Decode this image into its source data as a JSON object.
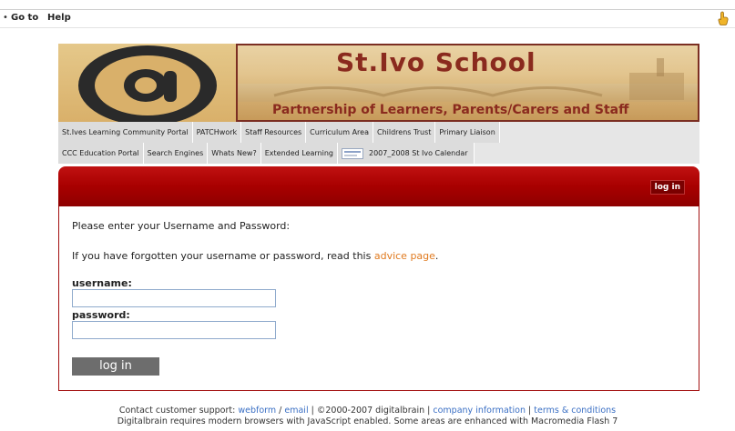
{
  "menubar": {
    "bullet": "•",
    "items": [
      "Go to",
      "Help"
    ]
  },
  "banner": {
    "logo_symbol": "@",
    "school_name": "St.Ivo School",
    "tagline": "Partnership of Learners, Parents/Carers and Staff"
  },
  "nav": {
    "row1": [
      "St.Ives Learning Community Portal",
      "PATCHwork",
      "Staff Resources",
      "Curriculum Area",
      "Childrens Trust",
      "Primary Liaison"
    ],
    "row2": [
      "CCC Education Portal",
      "Search Engines",
      "Whats New?",
      "Extended Learning"
    ],
    "calendar": "2007_2008 St Ivo Calendar"
  },
  "login": {
    "header_link": "log in",
    "prompt": "Please enter your Username and Password:",
    "forgot_text": "If you have forgotten your username or password, read this",
    "advice_link": "advice page",
    "forgot_end": ".",
    "username_label": "username:",
    "password_label": "password:",
    "username_value": "",
    "password_value": "",
    "submit_label": "log in"
  },
  "footer": {
    "support_prefix": "Contact customer support:",
    "webform": "webform",
    "slash": "/",
    "email": "email",
    "sep1": "|",
    "copyright": "©2000-2007 digitalbrain",
    "sep2": "|",
    "company": "company information",
    "sep3": "|",
    "terms": "terms & conditions",
    "line2": "Digitalbrain requires modern browsers with JavaScript enabled. Some areas are enhanced with Macromedia Flash 7"
  },
  "colors": {
    "accent_red": "#a80000",
    "link_orange": "#e07a1f",
    "link_blue": "#3a6fc4",
    "banner_brown": "#8a2a1e"
  },
  "icons": {
    "menubar_right": "hand-pointer-icon",
    "calendar": "calendar-thumbnail-icon"
  }
}
